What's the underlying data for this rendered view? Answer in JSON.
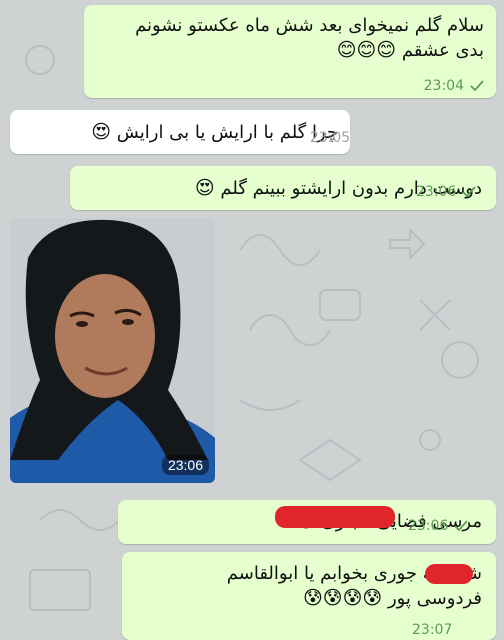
{
  "colors": {
    "chat_bg": "#ced2d3",
    "outgoing_bubble": "#e6ffcf",
    "incoming_bubble": "#ffffff",
    "outgoing_time": "#5e9a57",
    "redaction": "#e0262b"
  },
  "messages": [
    {
      "text_line1": "سلام گلم نمیخوای بعد شش ماه عکستو نشونم",
      "text_line2": "بدی عشقم",
      "emoji": "😊😊😊",
      "time": "23:04",
      "icon": "double-check-icon"
    },
    {
      "text": "چرا گلم با ارایش یا بی ارایش",
      "emoji": "😍",
      "time": "23:05"
    },
    {
      "text": "دوست دارم بدون ارایشتو ببینم گلم",
      "emoji": "😍",
      "time": "23:06",
      "icon": "double-check-icon"
    },
    {
      "time": "23:06",
      "image": "photo-of-person-in-black-headscarf"
    },
    {
      "text": "مرسی",
      "text_end": "فضایی مجازی",
      "emoji": "😑",
      "time": "23:06",
      "icon": "double-check-icon"
    },
    {
      "text_line1": "شب چه جوری بخوابم  یا ابوالقاسم",
      "text_line2": "فردوسی پور",
      "emoji": "😰😰😰😰",
      "time": "23:07"
    }
  ]
}
